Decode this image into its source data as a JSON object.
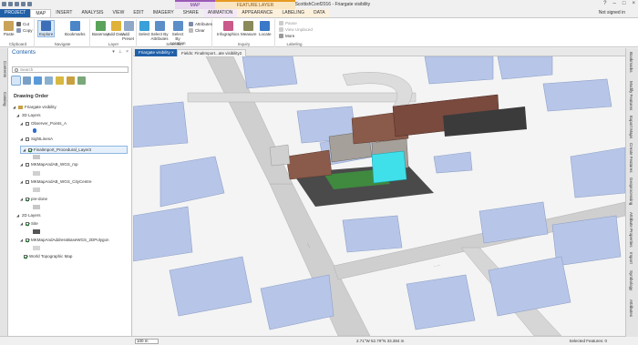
{
  "window": {
    "title": "ArcGIS Pro - ScottishConf2016 - Friargate visibility",
    "context_map": "MAP",
    "context_feature": "FEATURE LAYER",
    "sign_in": "Not signed in"
  },
  "tabs": [
    "PROJECT",
    "MAP",
    "INSERT",
    "ANALYSIS",
    "VIEW",
    "EDIT",
    "IMAGERY",
    "SHARE",
    "ANIMATION",
    "APPEARANCE",
    "LABELING",
    "DATA"
  ],
  "ribbon": {
    "clipboard": {
      "label": "Clipboard",
      "paste": "Paste",
      "cut": "Cut",
      "copy": "Copy"
    },
    "navigate": {
      "label": "Navigate",
      "explore": "Explore",
      "bookmarks": "Bookmarks"
    },
    "layer": {
      "label": "Layer",
      "basemap": "Basemap",
      "add_data": "Add Data",
      "add_preset": "Add Preset"
    },
    "selection": {
      "label": "Selection",
      "select": "Select",
      "select_by_attributes": "Select By Attributes",
      "select_by_location": "Select By Location",
      "attributes": "Attributes",
      "clear": "Clear"
    },
    "inquiry": {
      "label": "Inquiry",
      "infographics": "Infographics",
      "measure": "Measure",
      "locate": "Locate"
    },
    "labeling": {
      "label": "Labeling",
      "pause": "Pause",
      "view_unplaced": "View Unplaced",
      "more": "More"
    }
  },
  "left_strip": [
    "Contents",
    "Catalog"
  ],
  "contents": {
    "title": "Contents",
    "search_placeholder": "Search",
    "drawing_order": "Drawing Order",
    "items": [
      "Friargate visibility",
      "3D Layers",
      "Observer_Points_A",
      "SightLinesA",
      "FinalImport_Procedural_Layer3",
      "MKMapAndAB_WGS_mp",
      "MKMapAndAB_WGS_CityCentre",
      "pre-done",
      "2D Layers",
      "Site",
      "MKMapAndAddressBaseWGS_2DPolygon",
      "World Topographic Map"
    ]
  },
  "map_tabs": [
    "Friargate visibility",
    "Fields: FinalImport...ate visibility2"
  ],
  "right_strip": [
    "Bookmarks",
    "Modify Features",
    "Export Maps",
    "Create Features",
    "Geoprocessing",
    "Attribute Properties",
    "Import",
    "Symbology",
    "Attributes"
  ],
  "status": {
    "scale": "100 m",
    "coords": "2.71°W 52.79°N  33.384 m",
    "selected": "Selected Features: 0"
  },
  "colors": {
    "project_tab": "#1f5fa8",
    "building": "#b4c4e6",
    "highlight": "#3fe0ea"
  }
}
